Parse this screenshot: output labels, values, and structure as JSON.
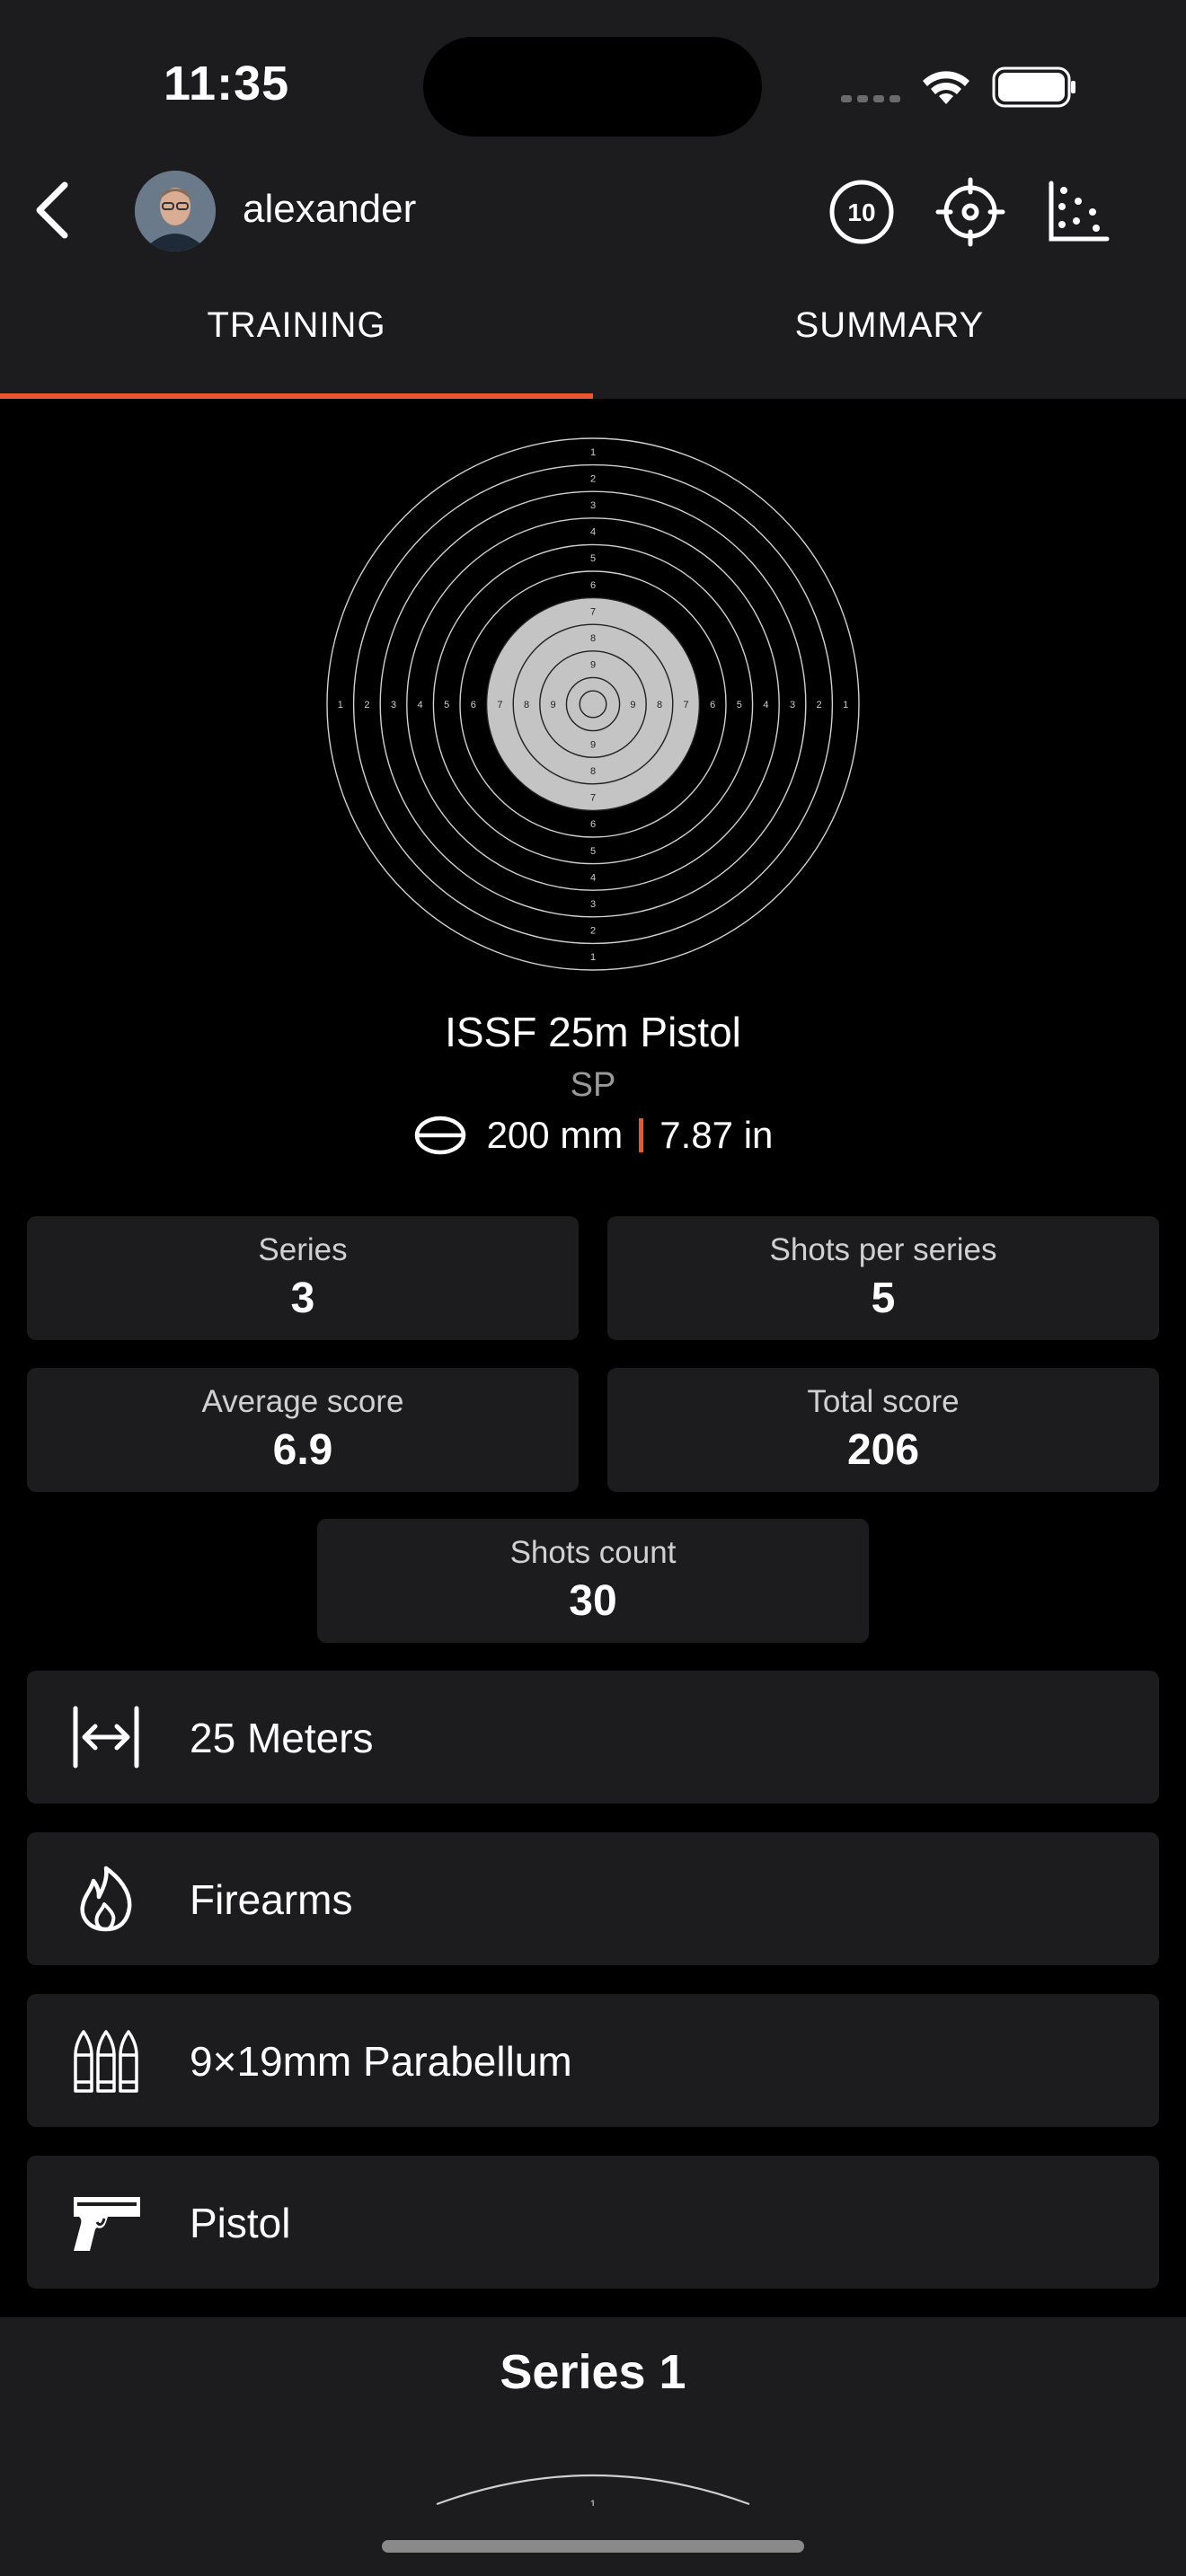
{
  "status_bar": {
    "time": "11:35"
  },
  "header": {
    "username": "alexander",
    "icons": [
      "back-icon",
      "score-ten-icon",
      "crosshair-icon",
      "scatter-plot-icon"
    ],
    "score_badge": "10"
  },
  "tabs": [
    {
      "label": "TRAINING",
      "active": true
    },
    {
      "label": "SUMMARY",
      "active": false
    }
  ],
  "colors": {
    "accent": "#e8572e",
    "card": "#1c1c1e",
    "background": "#000000",
    "target_center": "#c4c4c4"
  },
  "target": {
    "ring_labels": [
      "1",
      "2",
      "3",
      "4",
      "5",
      "6",
      "7",
      "8",
      "9"
    ],
    "title": "ISSF 25m Pistol",
    "subtitle": "SP",
    "size_mm": "200 mm",
    "size_in": "7.87 in"
  },
  "stats": {
    "series": {
      "label": "Series",
      "value": "3"
    },
    "shots_per_series": {
      "label": "Shots per series",
      "value": "5"
    },
    "average_score": {
      "label": "Average score",
      "value": "6.9"
    },
    "total_score": {
      "label": "Total score",
      "value": "206"
    },
    "shots_count": {
      "label": "Shots count",
      "value": "30"
    }
  },
  "details": [
    {
      "icon": "distance-icon",
      "label": "25 Meters"
    },
    {
      "icon": "fire-icon",
      "label": "Firearms"
    },
    {
      "icon": "ammo-icon",
      "label": "9×19mm Parabellum"
    },
    {
      "icon": "pistol-icon",
      "label": "Pistol"
    }
  ],
  "bottom": {
    "series_title": "Series 1",
    "partial_ring_label": "1"
  }
}
